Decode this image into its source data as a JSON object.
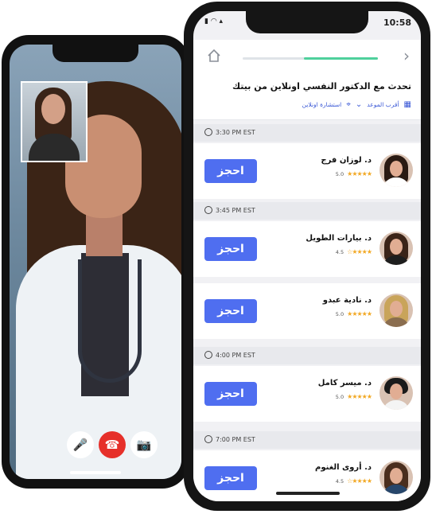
{
  "video_call": {
    "status_left": "",
    "controls": [
      "mute-icon",
      "end-call-icon",
      "camera-icon"
    ]
  },
  "app": {
    "status_time": "10:58",
    "title": "تحدث مع الدكتور النفسي اونلاين من بيتك",
    "filters": {
      "schedule": "أقرب الموعد",
      "consultation": "استشارة اونلاين"
    },
    "colors": {
      "accent": "#4f6ef0",
      "progress": "#4fd09c",
      "star": "#f2a823"
    },
    "progress_fraction": 0.55,
    "slots": [
      {
        "time": "3:30 PM EST"
      },
      {
        "time": "3:45 PM EST"
      },
      {
        "time": "4:00 PM EST"
      },
      {
        "time": "7:00 PM EST"
      }
    ],
    "doctors": [
      {
        "name": "د. لوزان فرج",
        "rating": "5.0",
        "stars": "★★★★★",
        "book": "احجز"
      },
      {
        "name": "د. بيارات الطويل",
        "rating": "4.5",
        "stars": "★★★★☆",
        "book": "احجز"
      },
      {
        "name": "د. نادية عبدو",
        "rating": "5.0",
        "stars": "★★★★★",
        "book": "احجز"
      },
      {
        "name": "د. ميسر كامل",
        "rating": "5.0",
        "stars": "★★★★★",
        "book": "احجز"
      },
      {
        "name": "د. أروى الغنوم",
        "rating": "4.5",
        "stars": "★★★★☆",
        "book": "احجز"
      }
    ]
  }
}
